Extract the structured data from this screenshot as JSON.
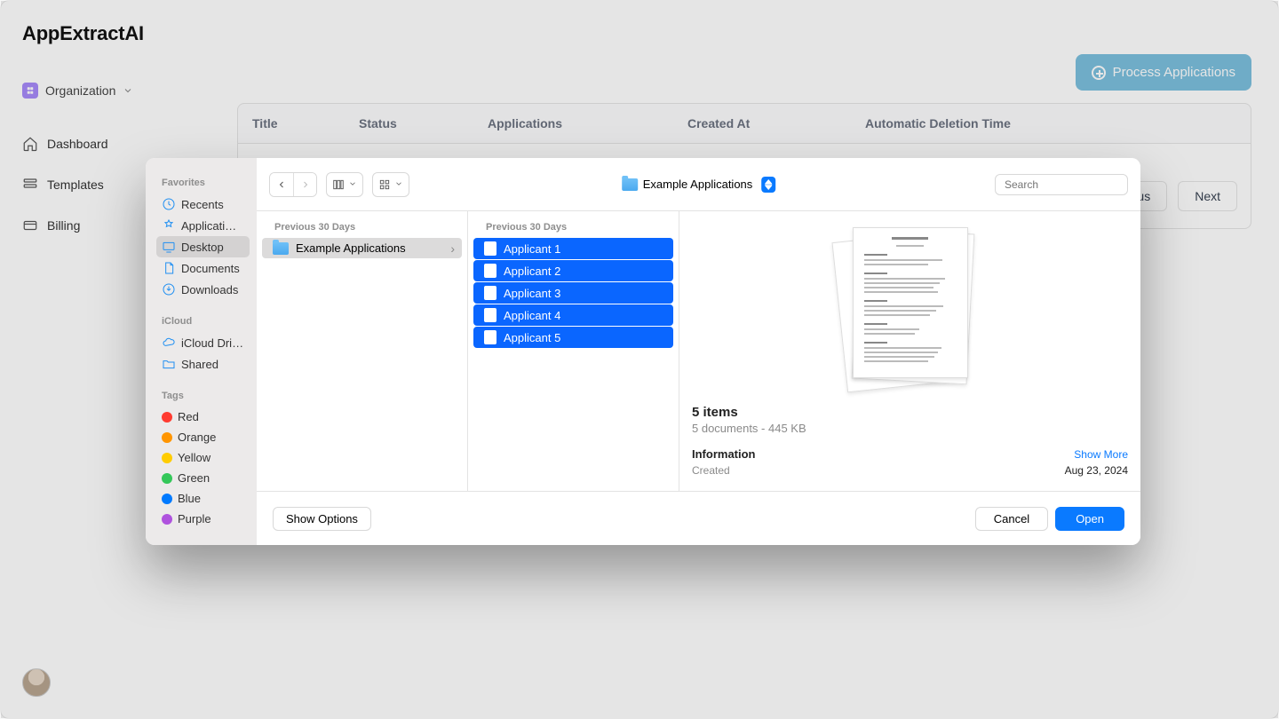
{
  "app": {
    "title": "AppExtractAI",
    "org_label": "Organization",
    "nav": {
      "dashboard": "Dashboard",
      "templates": "Templates",
      "billing": "Billing"
    },
    "process_button": "Process Applications",
    "table_headers": {
      "title": "Title",
      "status": "Status",
      "applications": "Applications",
      "created_at": "Created At",
      "auto_delete": "Automatic Deletion Time"
    },
    "pager": {
      "previous": "Previous",
      "next": "Next"
    }
  },
  "dialog": {
    "sidebar": {
      "favorites_label": "Favorites",
      "favorites": {
        "recents": "Recents",
        "applications": "Applicati…",
        "desktop": "Desktop",
        "documents": "Documents",
        "downloads": "Downloads"
      },
      "icloud_label": "iCloud",
      "icloud": {
        "drive": "iCloud Dri…",
        "shared": "Shared"
      },
      "tags_label": "Tags",
      "tags": [
        {
          "name": "Red",
          "color": "#ff3b30"
        },
        {
          "name": "Orange",
          "color": "#ff9500"
        },
        {
          "name": "Yellow",
          "color": "#ffcc00"
        },
        {
          "name": "Green",
          "color": "#34c759"
        },
        {
          "name": "Blue",
          "color": "#007aff"
        },
        {
          "name": "Purple",
          "color": "#af52de"
        }
      ]
    },
    "location": "Example Applications",
    "search_placeholder": "Search",
    "col1": {
      "header": "Previous 30 Days",
      "item": "Example Applications"
    },
    "col2": {
      "header": "Previous 30 Days",
      "items": [
        "Applicant 1",
        "Applicant 2",
        "Applicant 3",
        "Applicant 4",
        "Applicant 5"
      ]
    },
    "preview": {
      "title": "5 items",
      "subtitle": "5 documents - 445 KB",
      "info_label": "Information",
      "show_more": "Show More",
      "created_label": "Created",
      "created_value": "Aug 23, 2024"
    },
    "footer": {
      "show_options": "Show Options",
      "cancel": "Cancel",
      "open": "Open"
    }
  }
}
